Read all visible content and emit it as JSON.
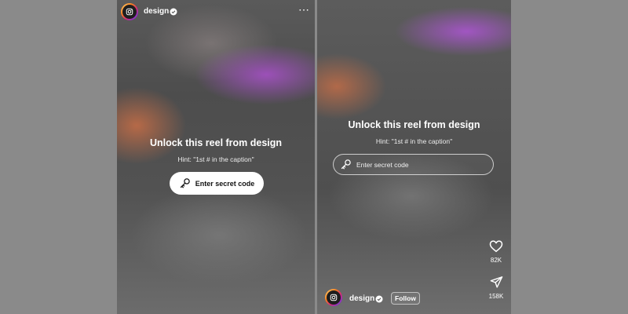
{
  "left_screen": {
    "username": "design",
    "title": "Unlock this reel from design",
    "hint": "Hint: \"1st # in the caption\"",
    "button_label": "Enter secret code",
    "more_icon": "⋯"
  },
  "right_screen": {
    "title": "Unlock this reel from design",
    "hint": "Hint: \"1st # in the caption\"",
    "input_placeholder": "Enter secret code",
    "likes_count": "82K",
    "shares_count": "158K",
    "username": "design",
    "follow_label": "Follow"
  },
  "icons": {
    "avatar": "instagram-logo-icon",
    "verified": "verified-badge-icon",
    "key": "key-icon",
    "like": "heart-icon",
    "share": "send-icon",
    "more": "more-dots-icon"
  },
  "colors": {
    "background": "#8a8a8a",
    "screen_dark": "#5e5e5e",
    "purple_blur": "#a050be",
    "orange_blur": "#c86e46",
    "button_bg": "#ffffff",
    "verified_blue": "#ffffff"
  }
}
